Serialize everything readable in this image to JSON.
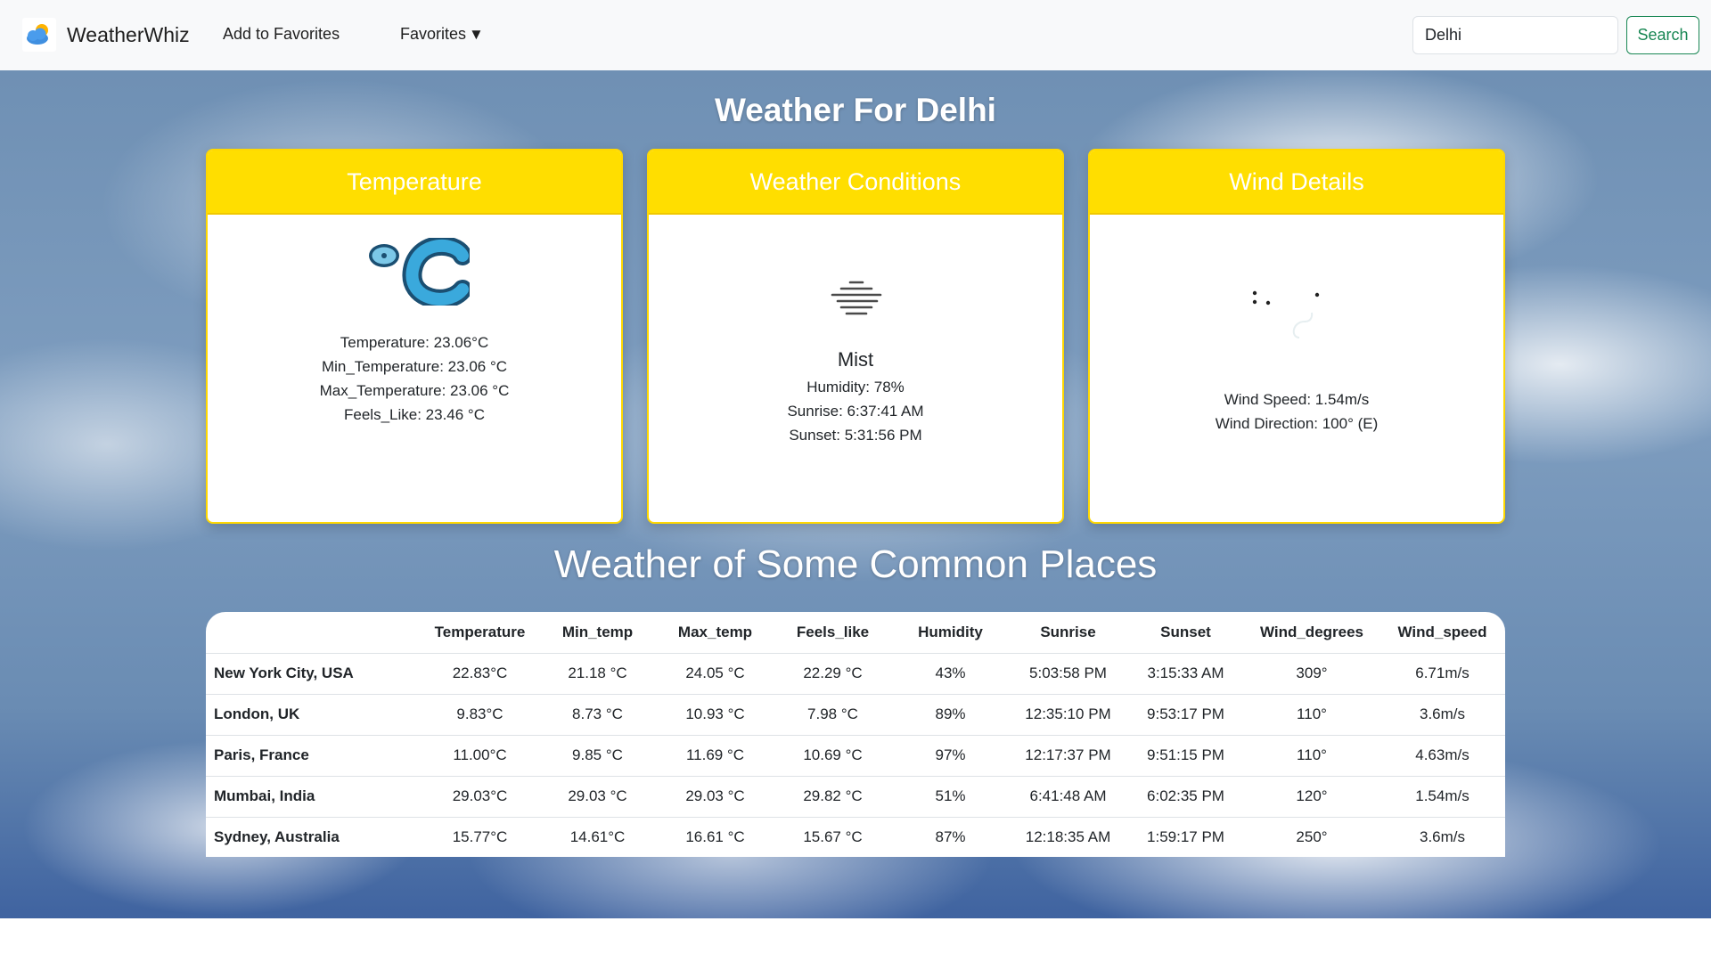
{
  "nav": {
    "brand": "WeatherWhiz",
    "add_favorites": "Add to Favorites",
    "favorites": "Favorites",
    "favorites_caret": "▼",
    "search_value": "Delhi",
    "search_button": "Search",
    "logo_icon": "cloud-sun-icon"
  },
  "main": {
    "title": "Weather For Delhi",
    "temperature_card": {
      "header": "Temperature",
      "icon": "celsius-icon",
      "lines": [
        "Temperature: 23.06°C",
        "Min_Temperature: 23.06 °C",
        "Max_Temperature: 23.06 °C",
        "Feels_Like: 23.46 °C"
      ]
    },
    "conditions_card": {
      "header": "Weather Conditions",
      "icon": "mist-icon",
      "condition": "Mist",
      "lines": [
        "Humidity: 78%",
        "Sunrise: 6:37:41 AM",
        "Sunset: 5:31:56 PM"
      ]
    },
    "wind_card": {
      "header": "Wind Details",
      "icon": "wind-icon",
      "lines": [
        "Wind Speed: 1.54m/s",
        "Wind Direction: 100° (E)"
      ]
    },
    "common_title": "Weather of Some Common Places",
    "table": {
      "headers": [
        "",
        "Temperature",
        "Min_temp",
        "Max_temp",
        "Feels_like",
        "Humidity",
        "Sunrise",
        "Sunset",
        "Wind_degrees",
        "Wind_speed"
      ],
      "rows": [
        [
          "New York City, USA",
          "22.83°C",
          "21.18 °C",
          "24.05 °C",
          "22.29 °C",
          "43%",
          "5:03:58 PM",
          "3:15:33 AM",
          "309°",
          "6.71m/s"
        ],
        [
          "London, UK",
          "9.83°C",
          "8.73 °C",
          "10.93 °C",
          "7.98 °C",
          "89%",
          "12:35:10 PM",
          "9:53:17 PM",
          "110°",
          "3.6m/s"
        ],
        [
          "Paris, France",
          "11.00°C",
          "9.85 °C",
          "11.69 °C",
          "10.69 °C",
          "97%",
          "12:17:37 PM",
          "9:51:15 PM",
          "110°",
          "4.63m/s"
        ],
        [
          "Mumbai, India",
          "29.03°C",
          "29.03 °C",
          "29.03 °C",
          "29.82 °C",
          "51%",
          "6:41:48 AM",
          "6:02:35 PM",
          "120°",
          "1.54m/s"
        ],
        [
          "Sydney, Australia",
          "15.77°C",
          "14.61°C",
          "16.61 °C",
          "15.67 °C",
          "87%",
          "12:18:35 AM",
          "1:59:17 PM",
          "250°",
          "3.6m/s"
        ]
      ]
    }
  },
  "colors": {
    "card_header": "#ffde00",
    "card_border": "#ffd800",
    "search_green": "#198754",
    "navbar_bg": "#f8f9fa"
  }
}
